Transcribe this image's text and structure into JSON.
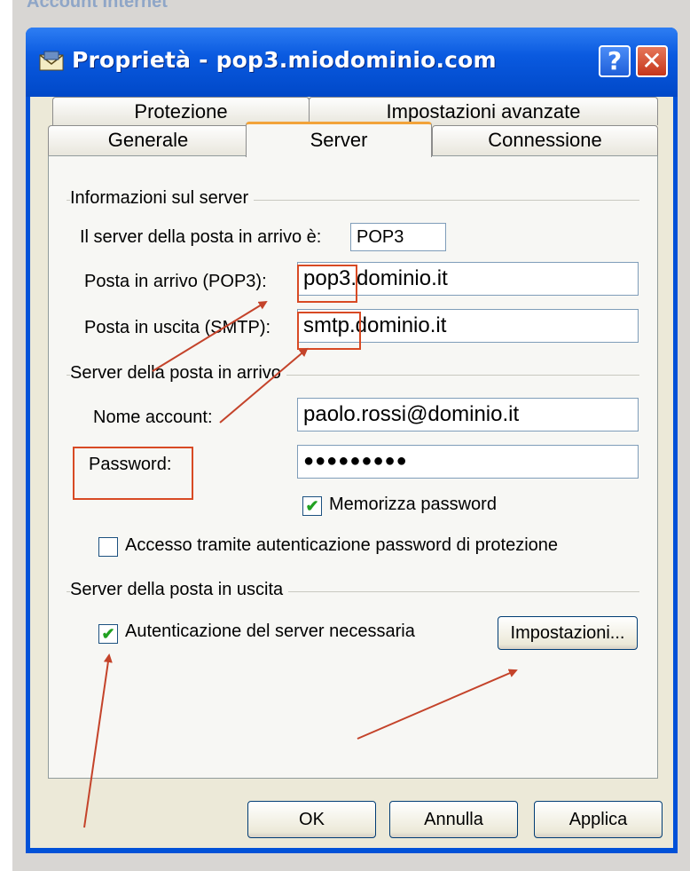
{
  "window": {
    "behind_title": "Account Internet",
    "title": "Proprietà - pop3.miodominio.com",
    "help_label": "?",
    "close_label": "✕"
  },
  "tabs": {
    "row1": [
      "Protezione",
      "Impostazioni avanzate"
    ],
    "row2": [
      "Generale",
      "Server",
      "Connessione"
    ],
    "active": "Server"
  },
  "server_info": {
    "group_title": "Informazioni sul server",
    "incoming_type_label": "Il server della posta in arrivo è:",
    "incoming_type_value": "POP3",
    "incoming_label": "Posta in arrivo (POP3):",
    "incoming_value": "pop3.dominio.it",
    "outgoing_label": "Posta in uscita (SMTP):",
    "outgoing_value": "smtp.dominio.it"
  },
  "incoming_server": {
    "group_title": "Server della posta in arrivo",
    "account_label": "Nome account:",
    "account_value": "paolo.rossi@dominio.it",
    "password_label": "Password:",
    "password_value": "●●●●●●●●●",
    "remember_label": "Memorizza password",
    "remember_checked": true,
    "spa_label": "Accesso tramite autenticazione password di protezione",
    "spa_checked": false
  },
  "outgoing_server": {
    "group_title": "Server della posta in uscita",
    "auth_label": "Autenticazione del server necessaria",
    "auth_checked": true,
    "settings_button": "Impostazioni..."
  },
  "buttons": {
    "ok": "OK",
    "cancel": "Annulla",
    "apply": "Applica"
  },
  "icons": {
    "check": "✔",
    "title_icon": "envelope-icon"
  },
  "colors": {
    "annotation": "#d84a24",
    "titlebar": "#0a5ae0"
  }
}
